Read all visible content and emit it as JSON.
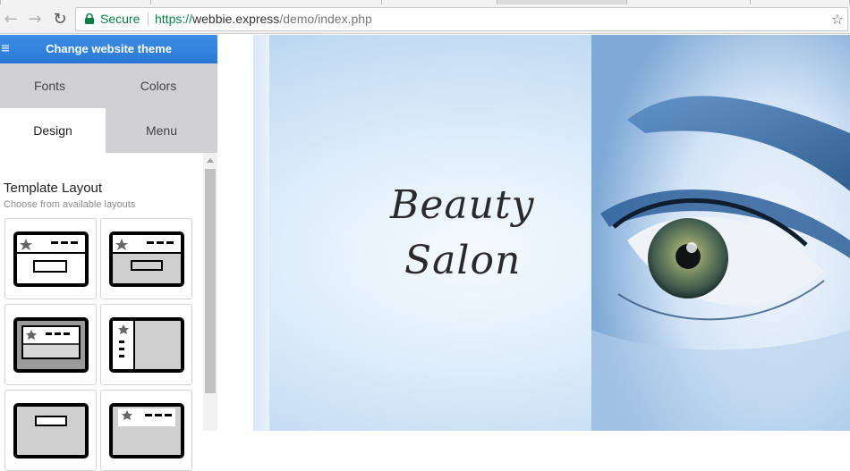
{
  "browser": {
    "secure_label": "Secure",
    "url_scheme": "https://",
    "url_host": "webbie.express",
    "url_path": "/demo/index.php",
    "back_icon": "back-arrow-icon",
    "forward_icon": "forward-arrow-icon",
    "reload_icon": "reload-icon",
    "bookmark_icon": "star-icon"
  },
  "panel": {
    "header_title": "Change website theme",
    "menu_icon": "hamburger-icon",
    "tabs": [
      {
        "label": "Fonts",
        "active": false
      },
      {
        "label": "Colors",
        "active": false
      },
      {
        "label": "Design",
        "active": true
      },
      {
        "label": "Menu",
        "active": false
      }
    ],
    "section_title": "Template Layout",
    "section_subtitle": "Choose from available layouts",
    "layouts": [
      {
        "variant": "header-top-white"
      },
      {
        "variant": "header-top-gray"
      },
      {
        "variant": "boxed-gray"
      },
      {
        "variant": "sidebar-left"
      },
      {
        "variant": "boxed-gray-partial"
      },
      {
        "variant": "header-top-gray-partial"
      }
    ]
  },
  "close_icon": "close-x-icon",
  "preview": {
    "title_line1": "Beauty",
    "title_line2": "Salon"
  },
  "colors": {
    "header_blue": "#2a79d6",
    "secure_green": "#0b8043",
    "tab_gray": "#d1d1d4",
    "preview_blue": "#c4dcf3"
  }
}
